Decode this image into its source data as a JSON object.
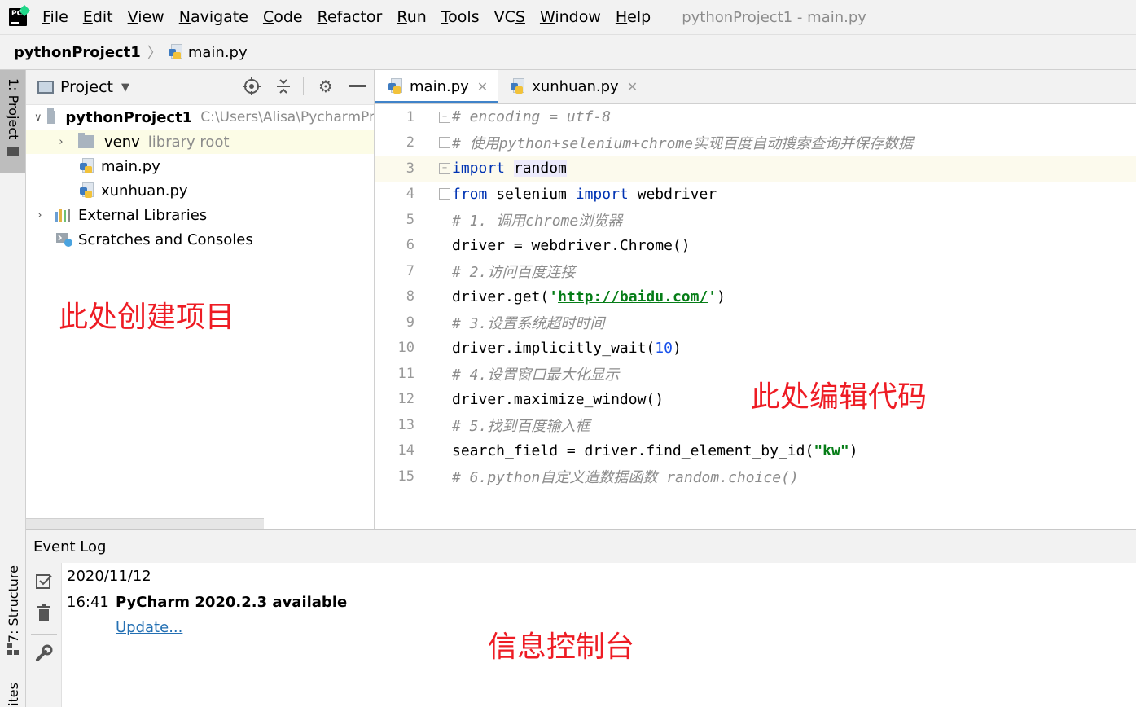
{
  "window": {
    "title": "pythonProject1 - main.py"
  },
  "menu": [
    {
      "label": "File",
      "mnemonic": "F",
      "rest": "ile"
    },
    {
      "label": "Edit",
      "mnemonic": "E",
      "rest": "dit"
    },
    {
      "label": "View",
      "mnemonic": "V",
      "rest": "iew"
    },
    {
      "label": "Navigate",
      "mnemonic": "N",
      "rest": "avigate"
    },
    {
      "label": "Code",
      "mnemonic": "C",
      "rest": "ode"
    },
    {
      "label": "Refactor",
      "mnemonic": "R",
      "rest": "efactor"
    },
    {
      "label": "Run",
      "mnemonic": "R",
      "rest": "un"
    },
    {
      "label": "Tools",
      "mnemonic": "T",
      "rest": "ools"
    },
    {
      "label": "VCS",
      "mnemonic": "S",
      "rest": "VC"
    },
    {
      "label": "Window",
      "mnemonic": "W",
      "rest": "indow"
    },
    {
      "label": "Help",
      "mnemonic": "H",
      "rest": "elp"
    }
  ],
  "navbar": {
    "project": "pythonProject1",
    "file": "main.py"
  },
  "left_strip": {
    "project_tab": "1: Project",
    "structure_tab": "7: Structure",
    "favorites_tab": "ites"
  },
  "project_panel": {
    "title": "Project",
    "tree": {
      "root": {
        "name": "pythonProject1",
        "path": "C:\\Users\\Alisa\\PycharmPr"
      },
      "venv": {
        "name": "venv",
        "note": "library root"
      },
      "file1": "main.py",
      "file2": "xunhuan.py",
      "external": "External Libraries",
      "scratches": "Scratches and Consoles"
    }
  },
  "editor": {
    "tabs": [
      {
        "label": "main.py",
        "active": true
      },
      {
        "label": "xunhuan.py",
        "active": false
      }
    ],
    "lines": [
      {
        "n": "1",
        "text": "# encoding = utf-8"
      },
      {
        "n": "2",
        "text": "# 使用python+selenium+chrome实现百度自动搜索查询并保存数据"
      },
      {
        "n": "3",
        "text": "import random"
      },
      {
        "n": "4",
        "text": "from selenium import webdriver"
      },
      {
        "n": "5",
        "text": "# 1. 调用chrome浏览器"
      },
      {
        "n": "6",
        "text": "driver = webdriver.Chrome()"
      },
      {
        "n": "7",
        "text": "# 2.访问百度连接"
      },
      {
        "n": "8",
        "text": "driver.get('http://baidu.com/')"
      },
      {
        "n": "9",
        "text": "# 3.设置系统超时时间"
      },
      {
        "n": "10",
        "text": "driver.implicitly_wait(10)"
      },
      {
        "n": "11",
        "text": "# 4.设置窗口最大化显示"
      },
      {
        "n": "12",
        "text": "driver.maximize_window()"
      },
      {
        "n": "13",
        "text": "# 5.找到百度输入框"
      },
      {
        "n": "14",
        "text": "search_field = driver.find_element_by_id(\"kw\")"
      },
      {
        "n": "15",
        "text": "# 6.python自定义造数据函数 random.choice()"
      }
    ]
  },
  "annotations": {
    "project": "此处创建项目",
    "editor": "此处编辑代码",
    "console": "信息控制台"
  },
  "event_log": {
    "title": "Event Log",
    "date": "2020/11/12",
    "time": "16:41",
    "message": "PyCharm 2020.2.3 available",
    "link": "Update..."
  },
  "colors": {
    "annotation_red": "#ee1c24",
    "keyword_blue": "#0033b3",
    "string_green": "#067d17",
    "link_blue": "#2470b3"
  }
}
